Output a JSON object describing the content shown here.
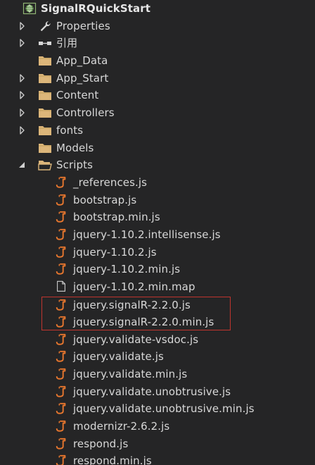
{
  "solution_explorer": {
    "project": {
      "label": "SignalRQuickStart",
      "icon": "web-project-globe-icon",
      "expanded": true
    },
    "items": [
      {
        "label": "Properties",
        "icon": "wrench-icon",
        "expandable": true,
        "expanded": false
      },
      {
        "label": "引用",
        "icon": "references-icon",
        "expandable": true,
        "expanded": false
      },
      {
        "label": "App_Data",
        "icon": "folder-icon",
        "expandable": false
      },
      {
        "label": "App_Start",
        "icon": "folder-icon",
        "expandable": true,
        "expanded": false
      },
      {
        "label": "Content",
        "icon": "folder-icon",
        "expandable": true,
        "expanded": false
      },
      {
        "label": "Controllers",
        "icon": "folder-icon",
        "expandable": true,
        "expanded": false
      },
      {
        "label": "fonts",
        "icon": "folder-icon",
        "expandable": true,
        "expanded": false
      },
      {
        "label": "Models",
        "icon": "folder-icon",
        "expandable": false
      },
      {
        "label": "Scripts",
        "icon": "folder-open-icon",
        "expandable": true,
        "expanded": true
      }
    ],
    "scripts": [
      {
        "label": "_references.js",
        "icon": "javascript-file-icon"
      },
      {
        "label": "bootstrap.js",
        "icon": "javascript-file-icon"
      },
      {
        "label": "bootstrap.min.js",
        "icon": "javascript-file-icon"
      },
      {
        "label": "jquery-1.10.2.intellisense.js",
        "icon": "javascript-file-icon"
      },
      {
        "label": "jquery-1.10.2.js",
        "icon": "javascript-file-icon"
      },
      {
        "label": "jquery-1.10.2.min.js",
        "icon": "javascript-file-icon"
      },
      {
        "label": "jquery-1.10.2.min.map",
        "icon": "document-file-icon"
      },
      {
        "label": "jquery.signalR-2.2.0.js",
        "icon": "javascript-file-icon"
      },
      {
        "label": "jquery.signalR-2.2.0.min.js",
        "icon": "javascript-file-icon"
      },
      {
        "label": "jquery.validate-vsdoc.js",
        "icon": "javascript-file-icon"
      },
      {
        "label": "jquery.validate.js",
        "icon": "javascript-file-icon"
      },
      {
        "label": "jquery.validate.min.js",
        "icon": "javascript-file-icon"
      },
      {
        "label": "jquery.validate.unobtrusive.js",
        "icon": "javascript-file-icon"
      },
      {
        "label": "jquery.validate.unobtrusive.min.js",
        "icon": "javascript-file-icon"
      },
      {
        "label": "modernizr-2.6.2.js",
        "icon": "javascript-file-icon"
      },
      {
        "label": "respond.js",
        "icon": "javascript-file-icon"
      },
      {
        "label": "respond.min.js",
        "icon": "javascript-file-icon"
      }
    ],
    "colors": {
      "background": "#252526",
      "text": "#d8d8d8",
      "folder": "#dcb67a",
      "js_file": "#e8772e",
      "highlight": "#c0352e"
    }
  }
}
